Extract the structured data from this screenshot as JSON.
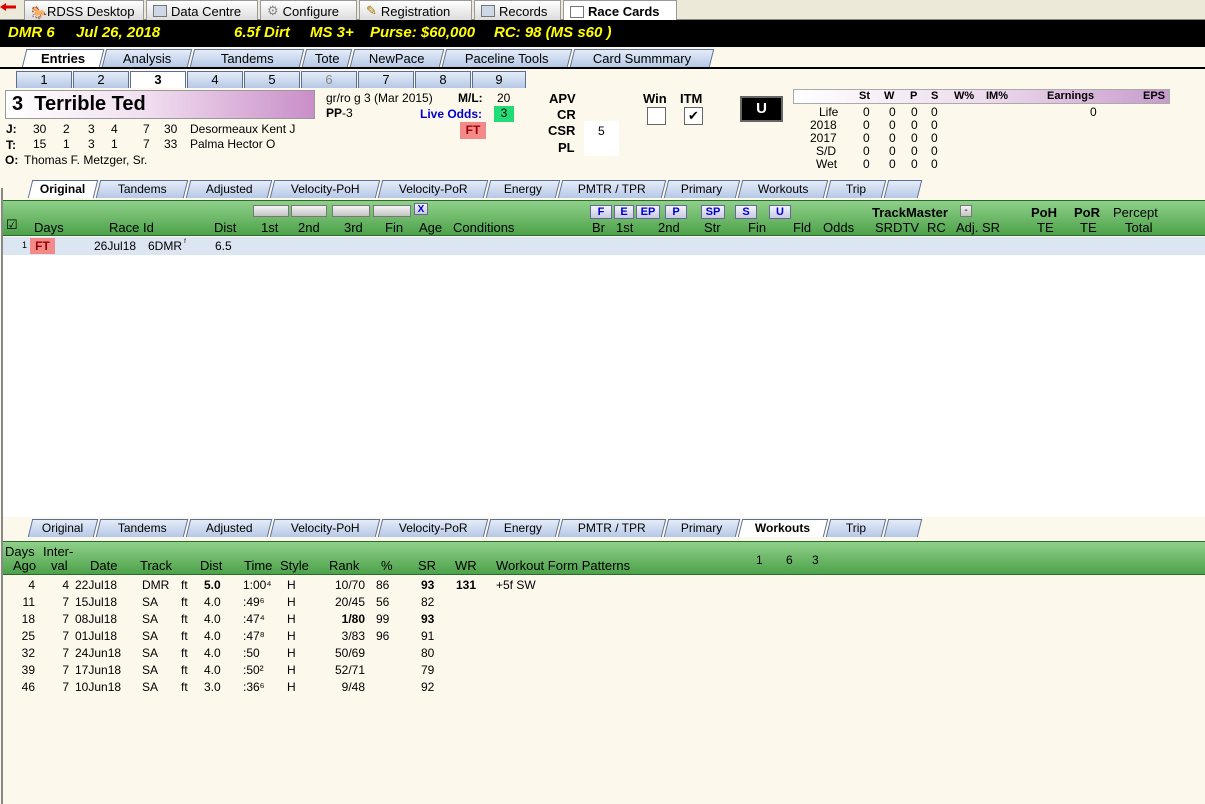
{
  "top_tabs": [
    {
      "label": "RDSS Desktop",
      "icon": "horse-icon"
    },
    {
      "label": "Data Centre",
      "icon": "database-icon"
    },
    {
      "label": "Configure",
      "icon": "gear-icon"
    },
    {
      "label": "Registration",
      "icon": "registration-icon"
    },
    {
      "label": "Records",
      "icon": "table-icon"
    },
    {
      "label": "Race Cards",
      "icon": "card-icon",
      "active": true
    }
  ],
  "race_bar": {
    "track_race": "DMR  6",
    "date": "Jul 26, 2018",
    "distance_surface": "6.5f  Dirt",
    "class": "MS  3+",
    "purse": "Purse: $60,000",
    "rc": "RC: 98  (MS s60 )"
  },
  "main_tabs": [
    "Entries",
    "Analysis",
    "Tandems",
    "Tote",
    "NewPace",
    "Paceline Tools",
    "Card Summmary"
  ],
  "entry_numbers": [
    "1",
    "2",
    "3",
    "4",
    "5",
    "6",
    "7",
    "8",
    "9"
  ],
  "horse": {
    "number": "3",
    "name": "Terrible Ted",
    "desc": "gr/ro g 3  (Mar 2015)",
    "pp_label": "PP",
    "pp_value": "-3",
    "ml_label": "M/L:",
    "ml_value": "20",
    "live_odds_label": "Live Odds:",
    "live_odds_value": "3",
    "ft_badge": "FT",
    "jockey_label": "J:",
    "jockey_stats": [
      "30",
      "2",
      "3",
      "4",
      "7",
      "30"
    ],
    "jockey_name": "Desormeaux Kent J",
    "trainer_label": "T:",
    "trainer_stats": [
      "15",
      "1",
      "3",
      "1",
      "7",
      "33"
    ],
    "trainer_name": "Palma Hector O",
    "owner_label": "O:",
    "owner_name": "Thomas F. Metzger, Sr."
  },
  "ratings": {
    "apv": "APV",
    "cr": "CR",
    "csr": "CSR",
    "csr_value": "5",
    "pl": "PL",
    "win": "Win",
    "itm": "ITM",
    "itm_check": "✔",
    "u_button": "U"
  },
  "stats": {
    "headers": [
      "St",
      "W",
      "P",
      "S",
      "W%",
      "IM%",
      "Earnings",
      "EPS"
    ],
    "rows": [
      {
        "label": "Life",
        "vals": [
          "0",
          "0",
          "0",
          "0"
        ],
        "earnings": "0"
      },
      {
        "label": "2018",
        "vals": [
          "0",
          "0",
          "0",
          "0"
        ],
        "earnings": ""
      },
      {
        "label": "2017",
        "vals": [
          "0",
          "0",
          "0",
          "0"
        ],
        "earnings": ""
      },
      {
        "label": "S/D",
        "vals": [
          "0",
          "0",
          "0",
          "0"
        ],
        "earnings": ""
      },
      {
        "label": "Wet",
        "vals": [
          "0",
          "0",
          "0",
          "0"
        ],
        "earnings": ""
      }
    ]
  },
  "sub_tabs": [
    "Original",
    "Tandems",
    "Adjusted",
    "Velocity-PoH",
    "Velocity-PoR",
    "Energy",
    "PMTR / TPR",
    "Primary",
    "Workouts",
    "Trip"
  ],
  "pp_header": {
    "check": "☑",
    "days": "Days",
    "race_id": "Race Id",
    "dist": "Dist",
    "c1st": "1st",
    "c2nd": "2nd",
    "c3rd": "3rd",
    "fin": "Fin",
    "age": "Age",
    "conditions": "Conditions",
    "x_btn": "X",
    "pace_btns": [
      "F",
      "E",
      "EP",
      "P",
      "SP",
      "S",
      "U"
    ],
    "br": "Br",
    "p1st": "1st",
    "p2nd": "2nd",
    "str": "Str",
    "pfin": "Fin",
    "fld": "Fld",
    "odds": "Odds",
    "trackmaster": "TrackMaster",
    "tm_btn": "-",
    "srdtv": "SRDTV",
    "rc": "RC",
    "adj_sr": "Adj. SR",
    "poh": "PoH",
    "por": "PoR",
    "te1": "TE",
    "te2": "TE",
    "percept": "Percept",
    "total": "Total"
  },
  "pp_rows": [
    {
      "idx": "1",
      "days": "FT",
      "race_date": "26Jul18",
      "race_id": "6DMR",
      "race_sup": "ᶠ",
      "dist": "6.5"
    }
  ],
  "workout_header": {
    "days_ago_1": "Days",
    "days_ago_2": "Ago",
    "interval_1": "Inter-",
    "interval_2": "val",
    "date": "Date",
    "track": "Track",
    "dist": "Dist",
    "time": "Time",
    "style": "Style",
    "rank": "Rank",
    "pct": "%",
    "sr": "SR",
    "wr": "WR",
    "patterns": "Workout Form Patterns",
    "pattern_nums": [
      "1",
      "6",
      "3"
    ]
  },
  "workouts": [
    {
      "ago": "4",
      "interval": "4",
      "date": "22Jul18",
      "track": "DMR",
      "cond": "ft",
      "dist": "5.0",
      "dist_bold": true,
      "time": "1:00⁴",
      "style": "H",
      "rank": "10/70",
      "rank_bold": false,
      "pct": "86",
      "sr": "93",
      "sr_bold": true,
      "wr": "131",
      "pattern": "+5f  SW"
    },
    {
      "ago": "11",
      "interval": "7",
      "date": "15Jul18",
      "track": "SA",
      "cond": "ft",
      "dist": "4.0",
      "dist_bold": false,
      "time": ":49⁶",
      "style": "H",
      "rank": "20/45",
      "rank_bold": false,
      "pct": "56",
      "sr": "82",
      "sr_bold": false,
      "wr": "",
      "pattern": ""
    },
    {
      "ago": "18",
      "interval": "7",
      "date": "08Jul18",
      "track": "SA",
      "cond": "ft",
      "dist": "4.0",
      "dist_bold": false,
      "time": ":47⁴",
      "style": "H",
      "rank": "1/80",
      "rank_bold": true,
      "pct": "99",
      "sr": "93",
      "sr_bold": true,
      "wr": "",
      "pattern": ""
    },
    {
      "ago": "25",
      "interval": "7",
      "date": "01Jul18",
      "track": "SA",
      "cond": "ft",
      "dist": "4.0",
      "dist_bold": false,
      "time": ":47⁸",
      "style": "H",
      "rank": "3/83",
      "rank_bold": false,
      "pct": "96",
      "sr": "91",
      "sr_bold": false,
      "wr": "",
      "pattern": ""
    },
    {
      "ago": "32",
      "interval": "7",
      "date": "24Jun18",
      "track": "SA",
      "cond": "ft",
      "dist": "4.0",
      "dist_bold": false,
      "time": ":50",
      "style": "H",
      "rank": "50/69",
      "rank_bold": false,
      "pct": "",
      "sr": "80",
      "sr_bold": false,
      "wr": "",
      "pattern": ""
    },
    {
      "ago": "39",
      "interval": "7",
      "date": "17Jun18",
      "track": "SA",
      "cond": "ft",
      "dist": "4.0",
      "dist_bold": false,
      "time": ":50²",
      "style": "H",
      "rank": "52/71",
      "rank_bold": false,
      "pct": "",
      "sr": "79",
      "sr_bold": false,
      "wr": "",
      "pattern": ""
    },
    {
      "ago": "46",
      "interval": "7",
      "date": "10Jun18",
      "track": "SA",
      "cond": "ft",
      "dist": "3.0",
      "dist_bold": false,
      "time": ":36⁶",
      "style": "H",
      "rank": "9/48",
      "rank_bold": false,
      "pct": "",
      "sr": "92",
      "sr_bold": false,
      "wr": "",
      "pattern": ""
    }
  ],
  "colors": {
    "race_bar_bg": "#000000",
    "race_bar_text": "#ffff00",
    "header_green": "#4da24a",
    "live_odds_green": "#22dd77",
    "ft_badge": "#f28a8a",
    "panel_bg": "#fdf8ec"
  }
}
